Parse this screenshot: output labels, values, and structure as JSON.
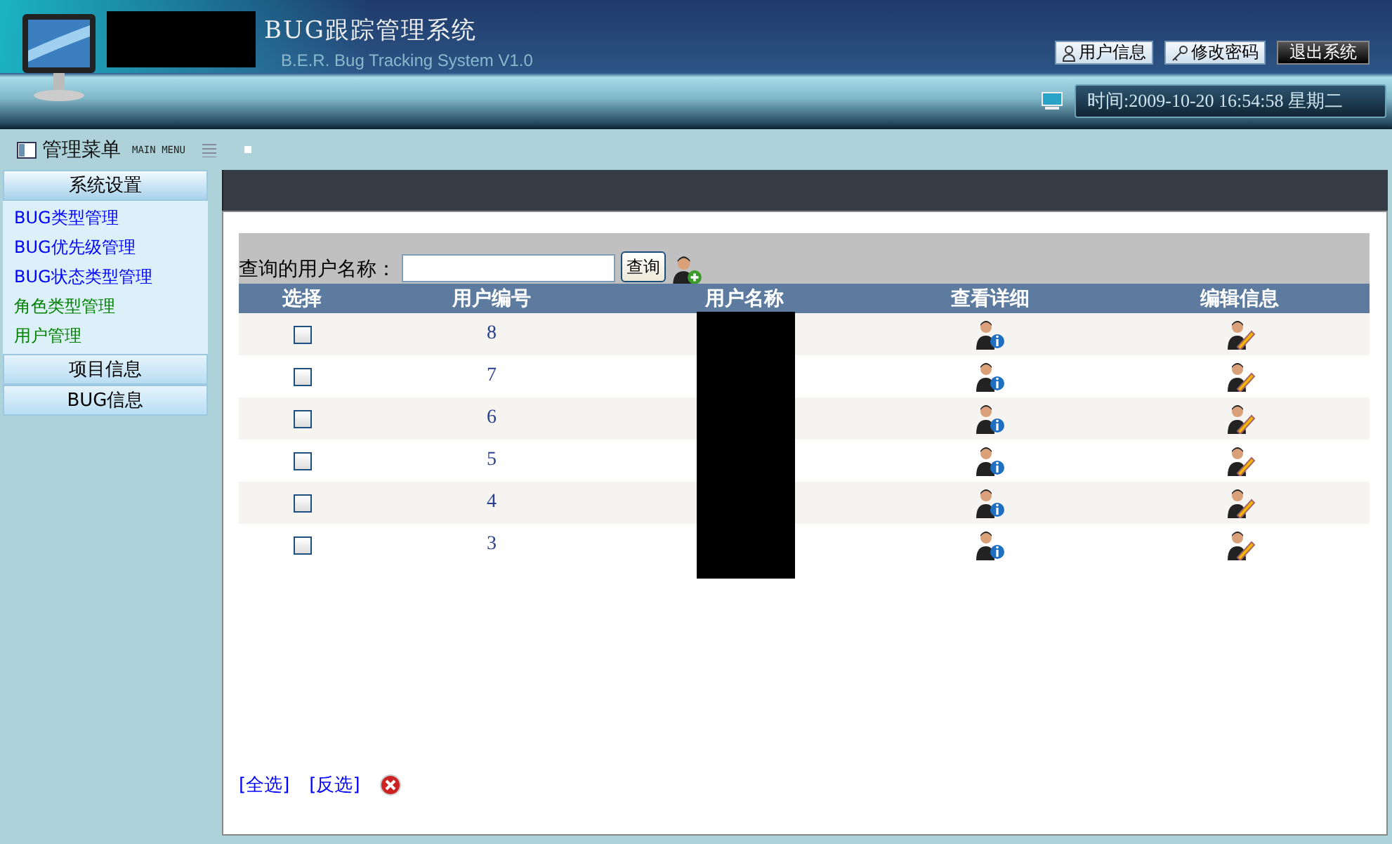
{
  "header": {
    "title": "BUG跟踪管理系统",
    "subtitle": "B.E.R. Bug Tracking System V1.0",
    "buttons": [
      {
        "label": "用户信息",
        "kind": "user"
      },
      {
        "label": "修改密码",
        "kind": "key"
      },
      {
        "label": "退出系统",
        "kind": "exit"
      }
    ],
    "clock": "时间:2009-10-20 16:54:58 星期二"
  },
  "menu_header": {
    "title": "管理菜单",
    "subtitle": "MAIN MENU"
  },
  "sidebar": [
    {
      "label": "系统设置",
      "expanded": true,
      "items": [
        {
          "label": "BUG类型管理",
          "color": "#0000ff"
        },
        {
          "label": "BUG优先级管理",
          "color": "#0000ff"
        },
        {
          "label": "BUG状态类型管理",
          "color": "#0000ff"
        },
        {
          "label": "角色类型管理",
          "color": "#008000"
        },
        {
          "label": "用户管理",
          "color": "#008000"
        }
      ]
    },
    {
      "label": "项目信息",
      "expanded": false
    },
    {
      "label": "BUG信息",
      "expanded": false
    }
  ],
  "search": {
    "label": "查询的用户名称：",
    "button": "查询"
  },
  "table": {
    "columns": [
      "选择",
      "用户编号",
      "用户名称",
      "查看详细",
      "编辑信息"
    ],
    "rows": [
      {
        "id": "8",
        "checked": false
      },
      {
        "id": "7",
        "checked": false
      },
      {
        "id": "6",
        "checked": false
      },
      {
        "id": "5",
        "checked": false
      },
      {
        "id": "4",
        "checked": false
      },
      {
        "id": "3",
        "checked": false
      }
    ]
  },
  "footer_links": [
    "[全选]",
    "[反选]"
  ]
}
